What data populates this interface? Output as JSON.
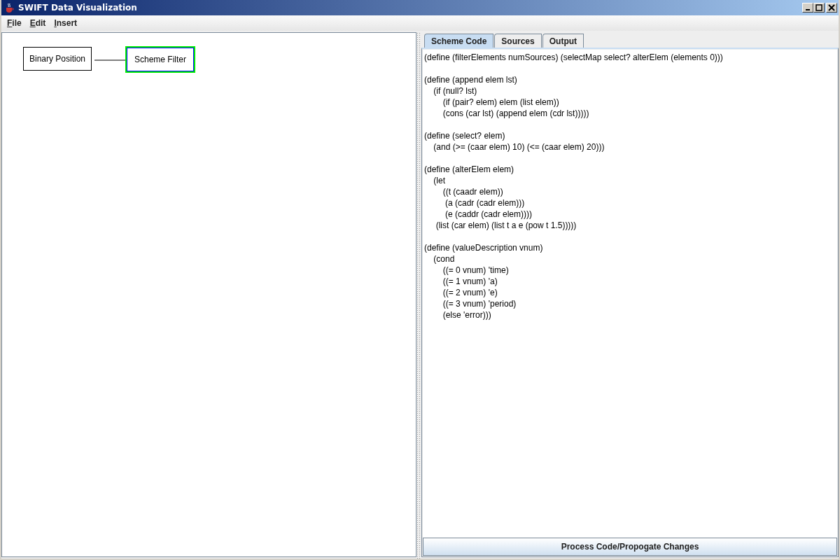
{
  "window": {
    "title": "SWIFT Data Visualization"
  },
  "menu": [
    "File",
    "Edit",
    "Insert"
  ],
  "canvas": {
    "nodes": [
      {
        "label": "Binary Position",
        "selected": false
      },
      {
        "label": "Scheme Filter",
        "selected": true
      }
    ]
  },
  "tabs": [
    {
      "label": "Scheme Code",
      "selected": true
    },
    {
      "label": "Sources",
      "selected": false
    },
    {
      "label": "Output",
      "selected": false
    }
  ],
  "code_blocks": [
    [
      "(define (filterElements numSources) (selectMap select? alterElem (elements 0)))"
    ],
    [
      "(define (append elem lst)",
      "    (if (null? lst)",
      "        (if (pair? elem) elem (list elem))",
      "        (cons (car lst) (append elem (cdr lst)))))"
    ],
    [
      "(define (select? elem)",
      "    (and (>= (caar elem) 10) (<= (caar elem) 20)))"
    ],
    [
      "(define (alterElem elem)",
      "    (let",
      "        ((t (caadr elem))",
      "         (a (cadr (cadr elem)))",
      "         (e (caddr (cadr elem))))",
      "     (list (car elem) (list t a e (pow t 1.5)))))"
    ],
    [
      "(define (valueDescription vnum)",
      "    (cond",
      "        ((= 0 vnum) 'time)",
      "        ((= 1 vnum) 'a)",
      "        ((= 2 vnum) 'e)",
      "        ((= 3 vnum) 'period)",
      "        (else 'error)))"
    ]
  ],
  "process_button": "Process Code/Propogate Changes"
}
